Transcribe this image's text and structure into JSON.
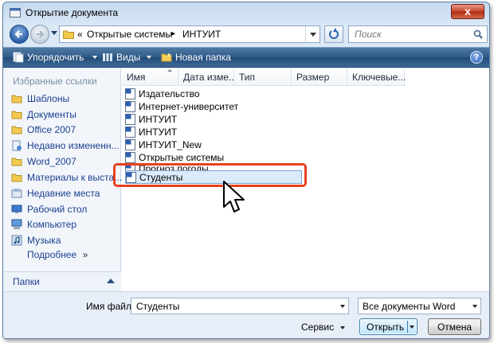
{
  "window": {
    "title": "Открытие документа",
    "close_label": "x"
  },
  "address_bar": {
    "segments": [
      "«",
      "Открытые системы",
      "▸",
      "ИНТУИТ"
    ]
  },
  "search": {
    "placeholder": "Поиск"
  },
  "toolbar": {
    "organize_label": "Упорядочить",
    "views_label": "Виды",
    "new_folder_label": "Новая папка",
    "help_label": "?"
  },
  "left_pane": {
    "heading": "Избранные ссылки",
    "links": [
      {
        "label": "Шаблоны",
        "icon": "folder-icon"
      },
      {
        "label": "Документы",
        "icon": "folder-icon"
      },
      {
        "label": "Office 2007",
        "icon": "folder-icon"
      },
      {
        "label": "Недавно измененн...",
        "icon": "recent-docs-icon"
      },
      {
        "label": "Word_2007",
        "icon": "folder-icon"
      },
      {
        "label": "Материалы к выста...",
        "icon": "folder-icon"
      },
      {
        "label": "Недавние места",
        "icon": "recent-places-icon"
      },
      {
        "label": "Рабочий стол",
        "icon": "desktop-icon"
      },
      {
        "label": "Компьютер",
        "icon": "computer-icon"
      },
      {
        "label": "Музыка",
        "icon": "music-icon"
      }
    ],
    "more_label": "Подробнее",
    "more_chevron": "»",
    "folders_label": "Папки"
  },
  "file_list": {
    "columns": [
      "Имя",
      "Дата изме...",
      "Тип",
      "Размер",
      "Ключевые..."
    ],
    "files": [
      "Издательство",
      "Интернет-университет",
      "ИНТУИТ",
      "ИНТУИТ",
      "ИНТУИТ_New",
      "Открытые системы",
      "Прогноз погоды",
      "Студенты"
    ],
    "selected_file": "Студенты"
  },
  "bottom": {
    "filename_label": "Имя файла:",
    "filename_value": "Студенты",
    "filetype_value": "Все документы Word",
    "service_label": "Сервис",
    "open_label": "Открыть",
    "cancel_label": "Отмена"
  },
  "colors": {
    "highlight_border": "#e8401f",
    "toolbar_bg": "#2e5a88",
    "link_text": "#1b3f8f",
    "selection_bg": "#dcebfc"
  }
}
